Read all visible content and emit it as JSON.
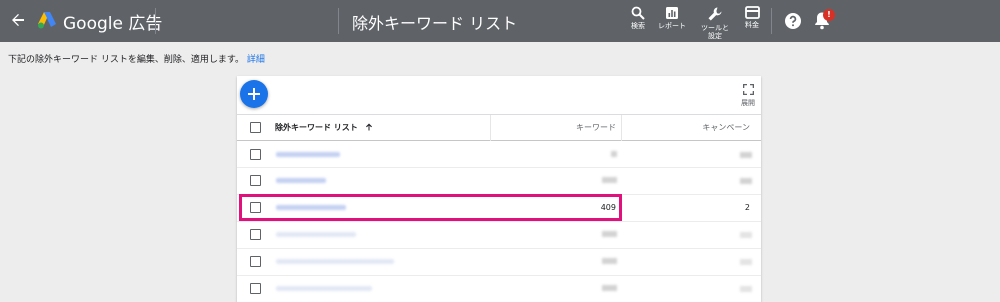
{
  "header": {
    "brand": "Google 広告",
    "page_title": "除外キーワード リスト",
    "tools": [
      {
        "label": "検索",
        "icon": "search-icon"
      },
      {
        "label": "レポート",
        "icon": "reports-icon"
      },
      {
        "label": "ツールと設定",
        "icon": "wrench-icon"
      },
      {
        "label": "料金",
        "icon": "billing-icon"
      }
    ],
    "notification_badge": "!"
  },
  "description": {
    "text": "下記の除外キーワード リストを編集、削除、適用します。",
    "link": "詳細"
  },
  "toolbar": {
    "expand_label": "展開"
  },
  "table": {
    "columns": [
      "除外キーワード リスト",
      "キーワード",
      "キャンペーン"
    ],
    "highlighted_row": {
      "keywords": "409",
      "campaigns": "2"
    }
  },
  "colors": {
    "topbar": "#5f6368",
    "accent": "#1a73e8",
    "highlight": "#e0117d",
    "badge": "#d93025"
  }
}
